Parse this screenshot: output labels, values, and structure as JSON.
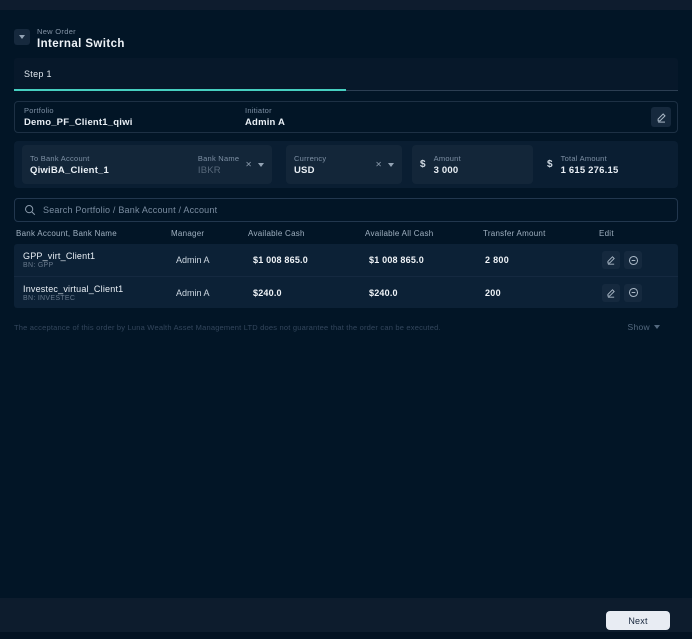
{
  "header": {
    "kicker": "New Order",
    "title": "Internal Switch"
  },
  "step": {
    "label": "Step 1"
  },
  "order_info": {
    "portfolio": {
      "label": "Portfolio",
      "value": "Demo_PF_Client1_qiwi"
    },
    "initiator": {
      "label": "Initiator",
      "value": "Admin A"
    }
  },
  "transfer_form": {
    "to_bank_account": {
      "label": "To Bank Account",
      "value": "QiwiBA_Client_1"
    },
    "bank_name": {
      "label": "Bank Name",
      "value": "IBKR"
    },
    "currency": {
      "label": "Currency",
      "value": "USD"
    },
    "currency_symbol": "$",
    "amount": {
      "label": "Amount",
      "value": "3 000"
    },
    "total_amount": {
      "label": "Total Amount",
      "value": "1 615 276.15"
    },
    "clear_icon": "✕"
  },
  "search": {
    "placeholder": "Search Portfolio / Bank Account / Account"
  },
  "table": {
    "columns": {
      "bank_account": "Bank Account, Bank Name",
      "manager": "Manager",
      "available_cash": "Available Cash",
      "available_all_cash": "Available All Cash",
      "transfer_amount": "Transfer Amount",
      "edit": "Edit"
    },
    "rows": [
      {
        "bank_account": "GPP_virt_Client1",
        "bank_name": "BN: GPP",
        "manager": "Admin A",
        "available_cash": "$1 008 865.0",
        "available_all_cash": "$1 008 865.0",
        "transfer_amount": "2 800"
      },
      {
        "bank_account": "Investec_virtual_Client1",
        "bank_name": "BN: INVESTEC",
        "manager": "Admin A",
        "available_cash": "$240.0",
        "available_all_cash": "$240.0",
        "transfer_amount": "200"
      }
    ]
  },
  "disclaimer": {
    "text": "The acceptance of this order by Luna Wealth Asset Management LTD does not guarantee that the order can be executed.",
    "toggle_label": "Show"
  },
  "footer": {
    "next_label": "Next"
  },
  "colors": {
    "background": "#021526",
    "panel": "#0a1e32",
    "inner_box": "#132639",
    "row": "#0c2136",
    "accent_teal": "#46cfc0",
    "next_button": "#e8ecf3"
  }
}
